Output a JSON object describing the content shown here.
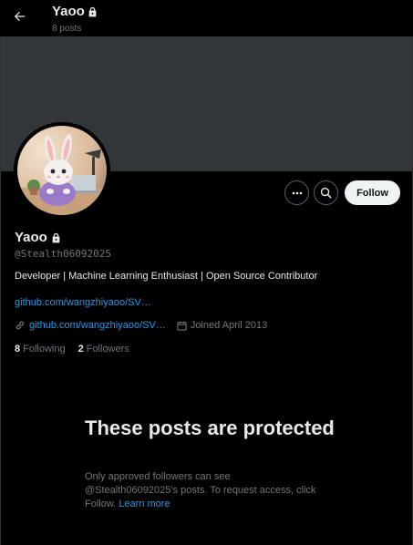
{
  "header": {
    "title": "Yaoo",
    "post_count": "8 posts"
  },
  "profile": {
    "name": "Yaoo",
    "handle": "@Stealth06092025",
    "bio": "Developer | Machine Learning Enthusiast | Open Source Contributor",
    "bio_link": "github.com/wangzhiyaoo/SV…",
    "website": "github.com/wangzhiyaoo/SV…",
    "joined": "Joined April 2013",
    "following_count": "8",
    "following_label": "Following",
    "followers_count": "2",
    "followers_label": "Followers"
  },
  "actions": {
    "follow_label": "Follow"
  },
  "protected": {
    "title": "These posts are protected",
    "message": "Only approved followers can see @Stealth06092025’s posts. To request access, click Follow.",
    "learn_more": "Learn more"
  },
  "icons": {
    "back": "arrow-left-icon",
    "lock": "lock-icon",
    "more": "more-horizontal-icon",
    "search": "search-icon",
    "link": "link-icon",
    "calendar": "calendar-icon"
  },
  "colors": {
    "background": "#000000",
    "banner": "#333639",
    "link": "#1d9bf0",
    "secondary_text": "#71767b",
    "follow_button": "#eff3f4"
  }
}
